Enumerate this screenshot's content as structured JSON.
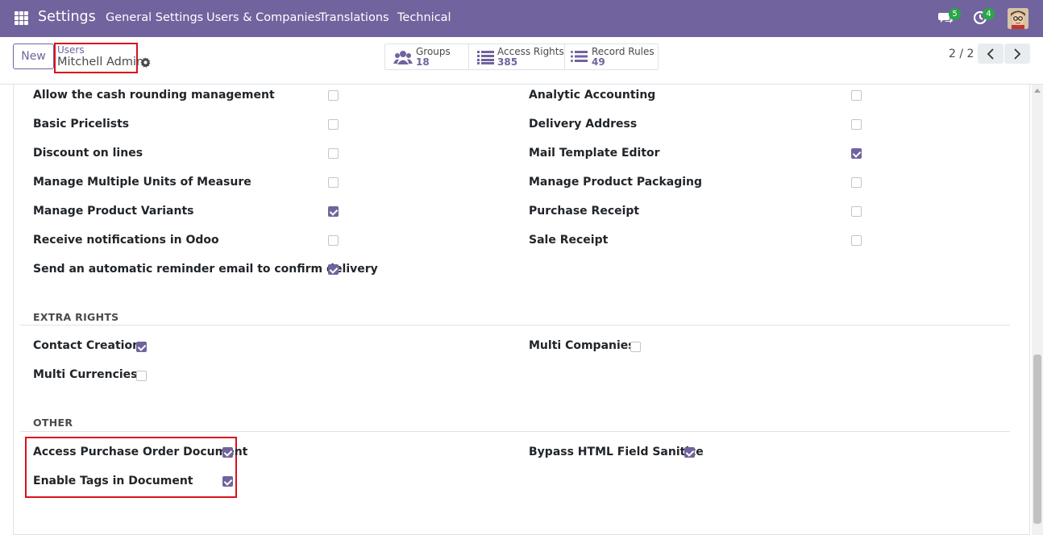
{
  "navbar": {
    "brand": "Settings",
    "menu": [
      "General Settings",
      "Users & Companies",
      "Translations",
      "Technical"
    ],
    "messages_count": "5",
    "activities_count": "4"
  },
  "control_panel": {
    "new_label": "New",
    "breadcrumb_parent": "Users",
    "breadcrumb_current": "Mitchell Admin",
    "smart_buttons": [
      {
        "label": "Groups",
        "value": "18",
        "icon": "users-icon"
      },
      {
        "label": "Access Rights",
        "value": "385",
        "icon": "list-icon"
      },
      {
        "label": "Record Rules",
        "value": "49",
        "icon": "list-icon"
      }
    ],
    "pager": "2 / 2"
  },
  "technical_rights": {
    "left": [
      {
        "label": "Allow the cash rounding management",
        "checked": false
      },
      {
        "label": "Basic Pricelists",
        "checked": false
      },
      {
        "label": "Discount on lines",
        "checked": false
      },
      {
        "label": "Manage Multiple Units of Measure",
        "checked": false
      },
      {
        "label": "Manage Product Variants",
        "checked": true
      },
      {
        "label": "Receive notifications in Odoo",
        "checked": false
      },
      {
        "label": "Send an automatic reminder email to confirm delivery",
        "checked": true
      }
    ],
    "right": [
      {
        "label": "Analytic Accounting",
        "checked": false
      },
      {
        "label": "Delivery Address",
        "checked": false
      },
      {
        "label": "Mail Template Editor",
        "checked": true
      },
      {
        "label": "Manage Product Packaging",
        "checked": false
      },
      {
        "label": "Purchase Receipt",
        "checked": false
      },
      {
        "label": "Sale Receipt",
        "checked": false
      }
    ]
  },
  "extra_rights": {
    "title": "EXTRA RIGHTS",
    "items": [
      {
        "label": "Contact Creation",
        "checked": true
      },
      {
        "label": "Multi Companies",
        "checked": false
      },
      {
        "label": "Multi Currencies",
        "checked": false
      }
    ]
  },
  "other": {
    "title": "OTHER",
    "items": [
      {
        "label": "Access Purchase Order Document",
        "checked": true
      },
      {
        "label": "Enable Tags in Document",
        "checked": true
      },
      {
        "label": "Bypass HTML Field Sanitize",
        "checked": true
      }
    ]
  },
  "colors": {
    "accent": "#71639e",
    "highlight": "#d9111c",
    "badge": "#28a745"
  }
}
